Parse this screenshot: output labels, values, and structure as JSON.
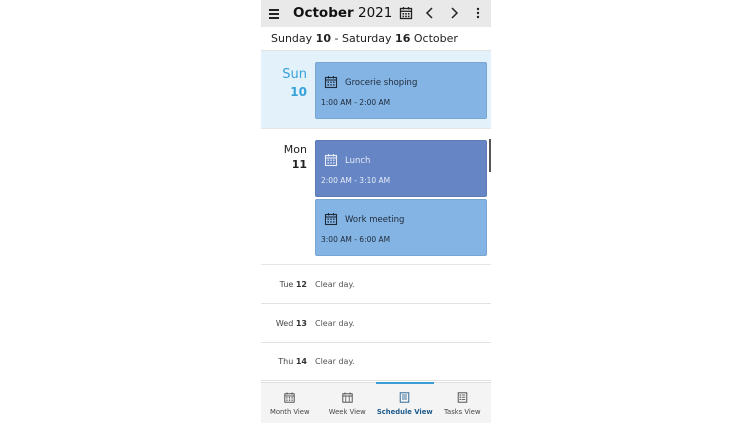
{
  "header": {
    "month": "October",
    "year": "2021",
    "menu_icon": "hamburger-icon",
    "calendar_icon": "calendar-icon",
    "prev_icon": "chevron-left-icon",
    "next_icon": "chevron-right-icon",
    "more_icon": "more-vertical-icon"
  },
  "range": {
    "start_day_name": "Sunday",
    "start_day_num": "10",
    "separator": "-",
    "end_day_name": "Saturday",
    "end_day_num": "16",
    "month": "October"
  },
  "days": {
    "sun": {
      "name": "Sun",
      "num": "10",
      "events": [
        {
          "title": "Grocerie shoping",
          "time": "1:00 AM - 2:00 AM",
          "color": "#84b4e3"
        }
      ]
    },
    "mon": {
      "name": "Mon",
      "num": "11",
      "events": [
        {
          "title": "Lunch",
          "time": "2:00 AM - 3:10 AM",
          "color": "#6585c4"
        },
        {
          "title": "Work meeting",
          "time": "3:00 AM - 6:00 AM",
          "color": "#84b4e3"
        }
      ]
    }
  },
  "clear_days": [
    {
      "name": "Tue",
      "num": "12",
      "text": "Clear day."
    },
    {
      "name": "Wed",
      "num": "13",
      "text": "Clear day."
    },
    {
      "name": "Thu",
      "num": "14",
      "text": "Clear day."
    }
  ],
  "bottom_nav": [
    {
      "label": "Month View",
      "icon": "calendar-month-icon",
      "active": false
    },
    {
      "label": "Week View",
      "icon": "calendar-week-icon",
      "active": false
    },
    {
      "label": "Schedule View",
      "icon": "schedule-list-icon",
      "active": true
    },
    {
      "label": "Tasks View",
      "icon": "tasks-list-icon",
      "active": false
    }
  ],
  "colors": {
    "accent": "#3f9bd4",
    "today_bg": "#e3f1fb",
    "today_text": "#37a2d8",
    "event_light": "#84b4e3",
    "event_dark": "#6585c4"
  }
}
